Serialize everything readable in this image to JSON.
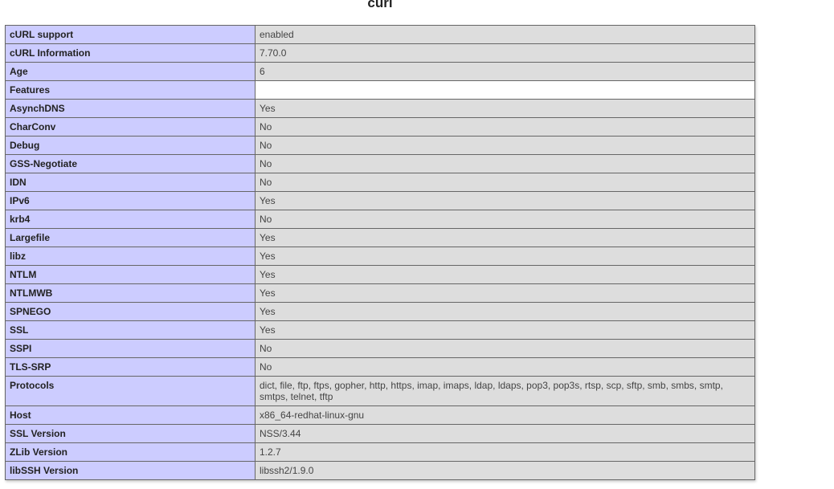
{
  "section": {
    "title": "curl"
  },
  "rows": [
    {
      "key": "cURL support",
      "value": "enabled"
    },
    {
      "key": "cURL Information",
      "value": "7.70.0"
    },
    {
      "key": "Age",
      "value": "6"
    },
    {
      "key": "Features",
      "value": ""
    },
    {
      "key": "AsynchDNS",
      "value": "Yes"
    },
    {
      "key": "CharConv",
      "value": "No"
    },
    {
      "key": "Debug",
      "value": "No"
    },
    {
      "key": "GSS-Negotiate",
      "value": "No"
    },
    {
      "key": "IDN",
      "value": "No"
    },
    {
      "key": "IPv6",
      "value": "Yes"
    },
    {
      "key": "krb4",
      "value": "No"
    },
    {
      "key": "Largefile",
      "value": "Yes"
    },
    {
      "key": "libz",
      "value": "Yes"
    },
    {
      "key": "NTLM",
      "value": "Yes"
    },
    {
      "key": "NTLMWB",
      "value": "Yes"
    },
    {
      "key": "SPNEGO",
      "value": "Yes"
    },
    {
      "key": "SSL",
      "value": "Yes"
    },
    {
      "key": "SSPI",
      "value": "No"
    },
    {
      "key": "TLS-SRP",
      "value": "No"
    },
    {
      "key": "Protocols",
      "value": "dict, file, ftp, ftps, gopher, http, https, imap, imaps, ldap, ldaps, pop3, pop3s, rtsp, scp, sftp, smb, smbs, smtp, smtps, telnet, tftp"
    },
    {
      "key": "Host",
      "value": "x86_64-redhat-linux-gnu"
    },
    {
      "key": "SSL Version",
      "value": "NSS/3.44"
    },
    {
      "key": "ZLib Version",
      "value": "1.2.7"
    },
    {
      "key": "libSSH Version",
      "value": "libssh2/1.9.0"
    }
  ],
  "colors": {
    "key_cell_bg": "#ccccff",
    "value_cell_bg": "#dddddd",
    "border": "#666666"
  }
}
